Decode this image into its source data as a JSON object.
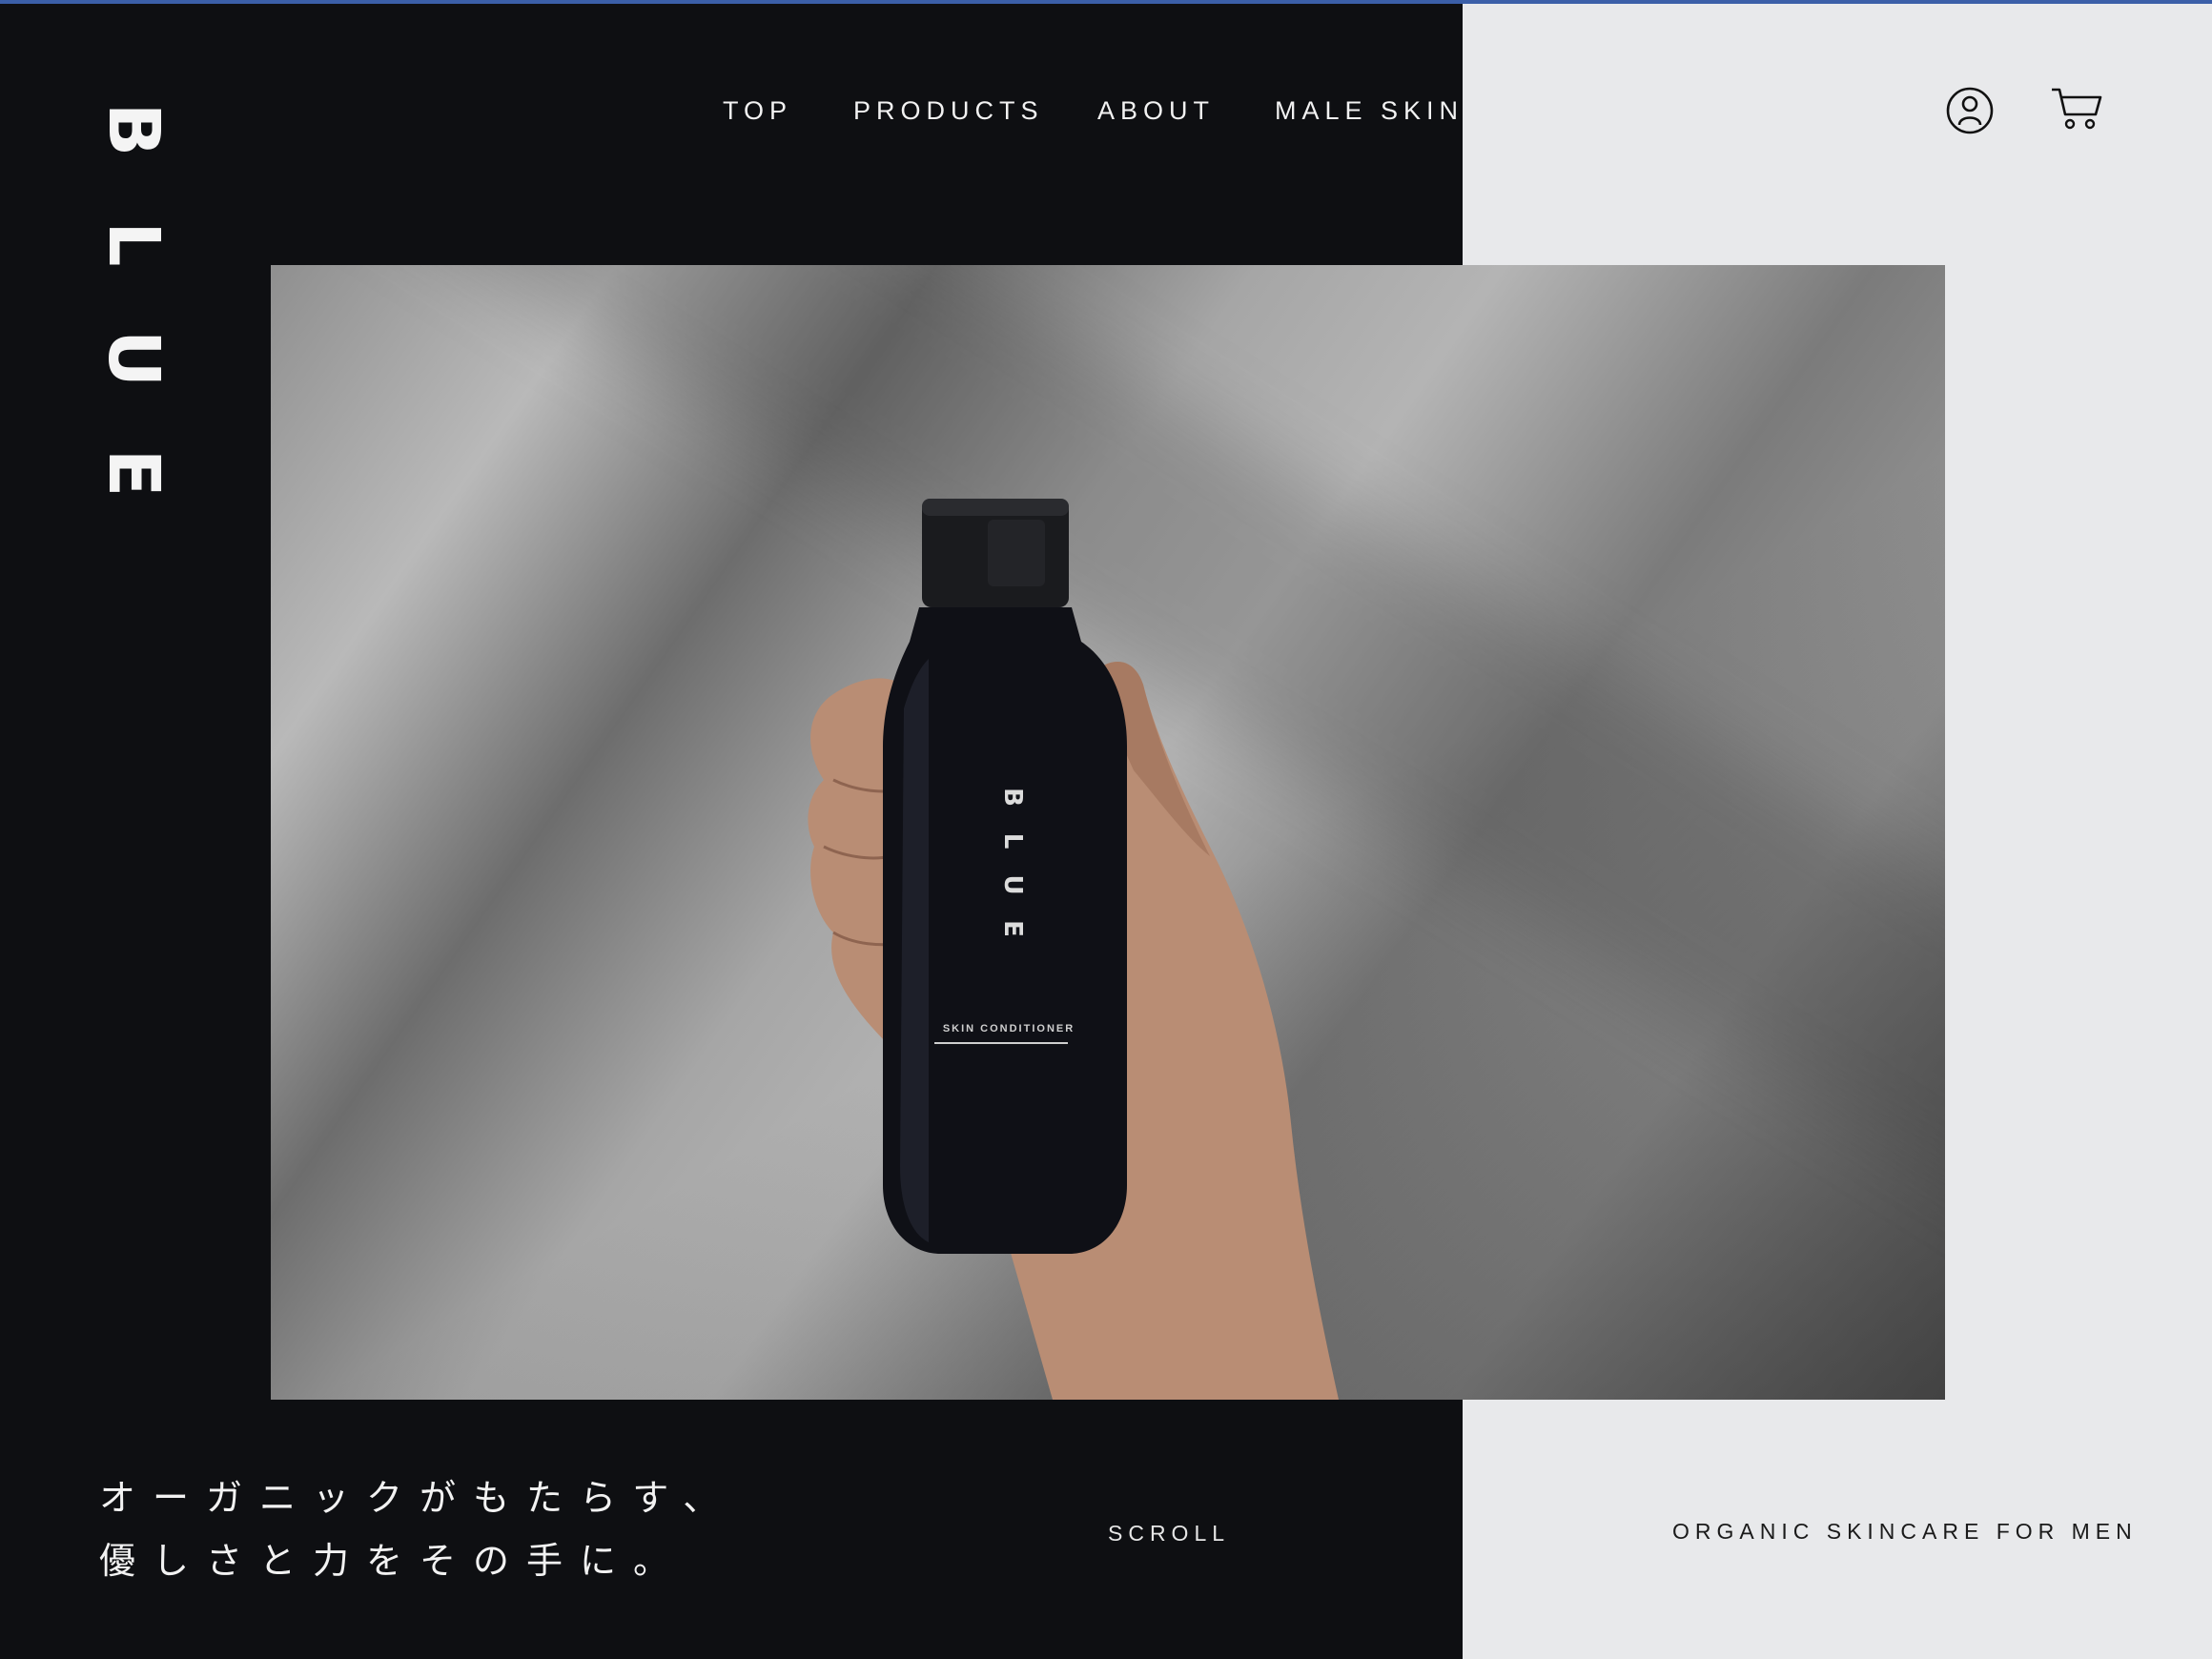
{
  "brand": {
    "logo_letters": [
      "B",
      "L",
      "U",
      "E"
    ]
  },
  "nav": {
    "items": [
      "TOP",
      "PRODUCTS",
      "ABOUT",
      "MALE SKIN"
    ]
  },
  "header_icons": [
    "user-account-icon",
    "cart-icon"
  ],
  "hero": {
    "product_brand": "BLUE",
    "product_label": "SKIN CONDITIONER"
  },
  "copy": {
    "line1": "オーガニックがもたらす、",
    "line2": "優しさと力をその手に。"
  },
  "scroll_label": "SCROLL",
  "tagline": "ORGANIC SKINCARE FOR MEN",
  "colors": {
    "dark_panel": "#0e0f12",
    "light_panel": "#e8e9eb",
    "text_light": "#f2f2f2",
    "text_dark": "#1a1a1a"
  }
}
